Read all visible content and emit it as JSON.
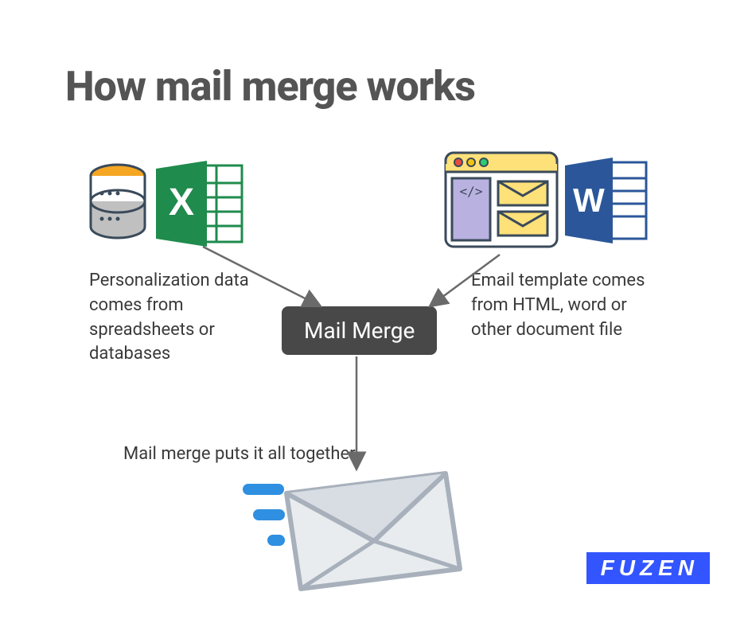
{
  "title": "How mail merge works",
  "left_label": "Personalization data comes from spreadsheets or databases",
  "right_label": "Email template comes from HTML, word or other document file",
  "center_label": "Mail Merge",
  "bottom_label": "Mail merge puts it all together",
  "logo_text": "FUZEN",
  "icons": {
    "database": "database-icon",
    "excel": "excel-icon",
    "html_window": "html-window-icon",
    "word": "word-icon",
    "envelope": "envelope-icon",
    "excel_letter": "X",
    "word_letter": "W"
  },
  "colors": {
    "title": "#545454",
    "text": "#3a3a3a",
    "box_bg": "#484848",
    "box_text": "#ffffff",
    "excel": "#1f8b4c",
    "word": "#2b579a",
    "logo_bg": "#3355ff",
    "db_top": "#F5A623",
    "db_bottom": "#C0C0C0",
    "envelope": "#d8dde3",
    "envelope_outline": "#a7b0bb",
    "accent_blue": "#2f8fe0"
  }
}
